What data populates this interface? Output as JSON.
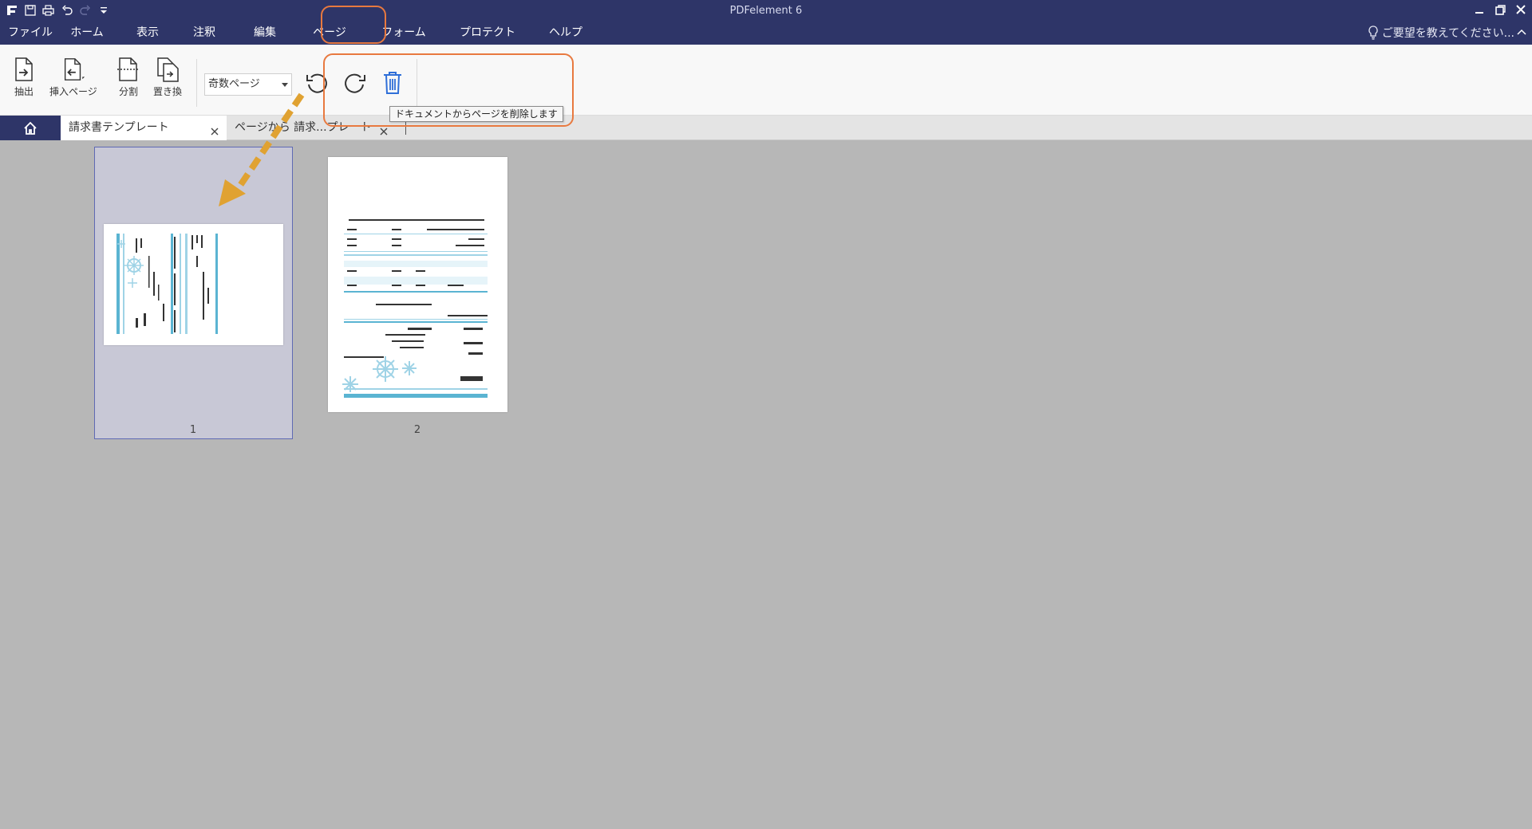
{
  "app": {
    "title": "PDFelement 6"
  },
  "menu": {
    "items": [
      "ファイル",
      "ホーム",
      "表示",
      "注釈",
      "編集",
      "ページ",
      "フォーム",
      "プロテクト",
      "ヘルプ"
    ],
    "active": "ページ"
  },
  "feedback": "ご要望を教えてください...",
  "ribbon": {
    "extract": "抽出",
    "insert": "挿入ページ",
    "split": "分割",
    "replace": "置き換",
    "page_select": "奇数ページ",
    "tooltip": "ドキュメントからページを削除します"
  },
  "tabs": [
    {
      "label": "請求書テンプレート"
    },
    {
      "label": "ページから 請求...プレート"
    }
  ],
  "pages": [
    "1",
    "2"
  ],
  "colors": {
    "title_bg": "#2e3568",
    "accent": "#e8793f",
    "arrow": "#e0a232",
    "invoice": "#5ab4d2",
    "delete_icon": "#2f6fd8"
  },
  "icons": [
    "app-logo-icon",
    "save-icon",
    "print-icon",
    "undo-icon",
    "redo-icon",
    "customize-icon",
    "minimize-icon",
    "restore-icon",
    "close-icon",
    "lightbulb-icon",
    "collapse-ribbon-icon",
    "extract-icon",
    "insert-page-icon",
    "split-icon",
    "replace-icon",
    "rotate-left-icon",
    "rotate-right-icon",
    "trash-icon",
    "home-icon"
  ]
}
